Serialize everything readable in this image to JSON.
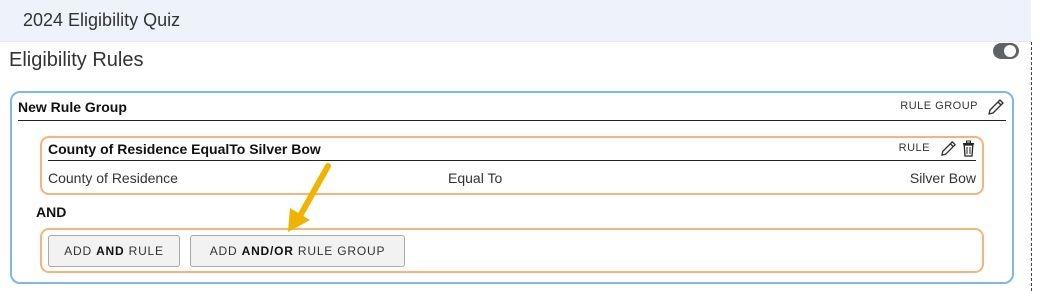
{
  "window": {
    "title": "2024 Eligibility Quiz"
  },
  "section": {
    "title": "Eligibility Rules",
    "toggle_on": true
  },
  "rule_group": {
    "name": "New Rule Group",
    "type_label": "RULE GROUP",
    "rule": {
      "name": "County of Residence EqualTo Silver Bow",
      "type_label": "RULE",
      "field": "County of Residence",
      "operator": "Equal To",
      "value": "Silver Bow"
    },
    "connector": "AND",
    "buttons": {
      "add_rule": {
        "prefix": "ADD ",
        "bold": "AND",
        "suffix": " RULE"
      },
      "add_group": {
        "prefix": "ADD ",
        "bold": "AND/OR",
        "suffix": " RULE GROUP"
      }
    }
  },
  "colors": {
    "titlebar_bg": "#eef3fb",
    "group_border": "#7cb8ee",
    "rule_border": "#f3b57a",
    "annotation_arrow": "#f0b400"
  },
  "icons": {
    "group_edit": "pencil-icon",
    "rule_edit": "pencil-icon",
    "rule_delete": "trash-icon",
    "annotation": "arrow-icon"
  }
}
